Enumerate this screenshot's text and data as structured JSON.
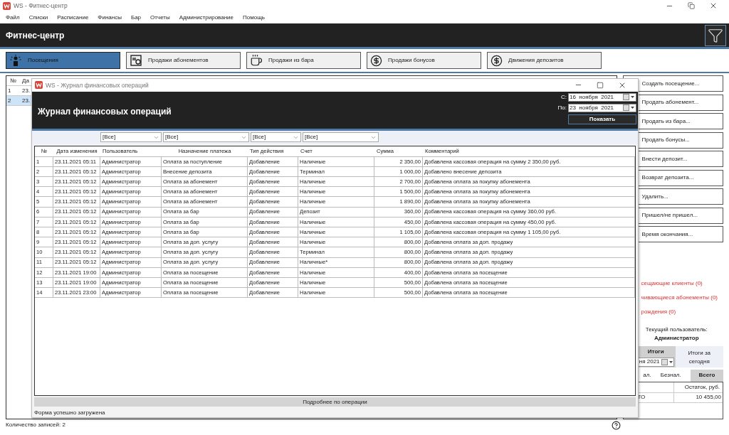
{
  "window": {
    "title": "WS - Фитнес-центр"
  },
  "menu": [
    "Файл",
    "Списки",
    "Расписание",
    "Финансы",
    "Бар",
    "Отчеты",
    "Администрирование",
    "Помощь"
  ],
  "header": {
    "title": "Фитнес-центр"
  },
  "tabs": [
    {
      "label": "Посещения",
      "selected": true,
      "kind": "person"
    },
    {
      "label": "Продажи абонементов",
      "selected": false,
      "kind": "card"
    },
    {
      "label": "Продажи из бара",
      "selected": false,
      "kind": "cup"
    },
    {
      "label": "Продажи бонусов",
      "selected": false,
      "kind": "money"
    },
    {
      "label": "Движения депозитов",
      "selected": false,
      "kind": "money"
    }
  ],
  "visits_table": {
    "columns": [
      "№",
      "Да"
    ],
    "rows": [
      {
        "cells": [
          "1",
          "23."
        ],
        "selected": false
      },
      {
        "cells": [
          "2",
          "23."
        ],
        "selected": true
      }
    ]
  },
  "actions": [
    "Создать посещение...",
    "Продать абонемент...",
    "Продать из бара...",
    "Продать бонусы...",
    "Внести депозит...",
    "Возврат депозита...",
    "Удалить...",
    "Пришел/не пришел...",
    "Время окончания..."
  ],
  "alerts": [
    "сещающие клиенты (0)",
    "чивающиеся абонементы (0)",
    "рождения (0)"
  ],
  "current_user": {
    "label": "Текущий пользователь:",
    "name": "Администратор"
  },
  "totals": {
    "tabs": [
      {
        "label": "Итоги",
        "selected": true
      },
      {
        "label": "Итоги за сегодня",
        "selected": false
      }
    ],
    "date": "ня 2021",
    "subtabs": [
      {
        "label": "ал.",
        "selected": false
      },
      {
        "label": "Безнал.",
        "selected": false
      },
      {
        "label": "Всего",
        "selected": true
      }
    ],
    "columns": [
      "",
      "Остаток, руб."
    ],
    "rows": [
      [
        "ТО",
        "10 455,00"
      ]
    ]
  },
  "status_bar": "Количество записей: 2",
  "dialog": {
    "title": "WS - Журнал финансовых операций",
    "heading": "Журнал финансовых операций",
    "from_label": "С:",
    "from_date": "16  ноября  2021",
    "to_label": "По:",
    "to_date": "23  ноября  2021",
    "show_button": "Показать",
    "filters": [
      "[Все]",
      "[Все]",
      "[Все]",
      "[Все]"
    ],
    "columns": [
      "№",
      "Дата изменения",
      "Пользователь",
      "Назначение платежа",
      "Тип действия",
      "Счет",
      "Сумма",
      "Комментарий"
    ],
    "rows": [
      [
        "1",
        "23.11.2021 05:11",
        "Администратор",
        "Оплата за поступление",
        "Добавление",
        "Наличные",
        "2 350,00",
        "Добавлена кассовая операция на сумму 2 350,00 руб."
      ],
      [
        "2",
        "23.11.2021 05:12",
        "Администратор",
        "Внесение депозита",
        "Добавление",
        "Терминал",
        "1 000,00",
        "Добавлено внесение депозита"
      ],
      [
        "3",
        "23.11.2021 05:12",
        "Администратор",
        "Оплата за абонемент",
        "Добавление",
        "Наличные",
        "2 700,00",
        "Добавлена оплата за покупку абонемента"
      ],
      [
        "4",
        "23.11.2021 05:12",
        "Администратор",
        "Оплата за абонемент",
        "Добавление",
        "Наличные",
        "1 500,00",
        "Добавлена оплата за покупку абонемента"
      ],
      [
        "5",
        "23.11.2021 05:12",
        "Администратор",
        "Оплата за абонемент",
        "Добавление",
        "Наличные",
        "1 890,00",
        "Добавлена оплата за покупку абонемента"
      ],
      [
        "6",
        "23.11.2021 05:12",
        "Администратор",
        "Оплата за бар",
        "Добавление",
        "Депозит",
        "360,00",
        "Добавлена кассовая операция на сумму 360,00 руб."
      ],
      [
        "7",
        "23.11.2021 05:12",
        "Администратор",
        "Оплата за бар",
        "Добавление",
        "Наличные",
        "450,00",
        "Добавлена кассовая операция на сумму 450,00 руб."
      ],
      [
        "8",
        "23.11.2021 05:12",
        "Администратор",
        "Оплата за бар",
        "Добавление",
        "Наличные",
        "1 105,00",
        "Добавлена кассовая операция на сумму 1 105,00 руб."
      ],
      [
        "9",
        "23.11.2021 05:12",
        "Администратор",
        "Оплата за доп. услугу",
        "Добавление",
        "Наличные",
        "800,00",
        "Добавлена оплата за доп. продажу"
      ],
      [
        "10",
        "23.11.2021 05:12",
        "Администратор",
        "Оплата за доп. услугу",
        "Добавление",
        "Терминал",
        "800,00",
        "Добавлена оплата за доп. продажу"
      ],
      [
        "11",
        "23.11.2021 05:12",
        "Администратор",
        "Оплата за доп. услугу",
        "Добавление",
        "Наличные*",
        "800,00",
        "Добавлена оплата за доп. продажу"
      ],
      [
        "12",
        "23.11.2021 19:00",
        "Администратор",
        "Оплата за посещение",
        "Добавление",
        "Наличные",
        "400,00",
        "Добавлена оплата за посещение"
      ],
      [
        "13",
        "23.11.2021 19:00",
        "Администратор",
        "Оплата за посещение",
        "Добавление",
        "Наличные",
        "500,00",
        "Добавлена оплата за посещение"
      ],
      [
        "14",
        "23.11.2021 23:00",
        "Администратор",
        "Оплата за посещение",
        "Добавление",
        "Наличные",
        "500,00",
        "Добавлена оплата за посещение"
      ]
    ],
    "details_button": "Подробнее по операции",
    "status": "Форма успешно загружена"
  }
}
